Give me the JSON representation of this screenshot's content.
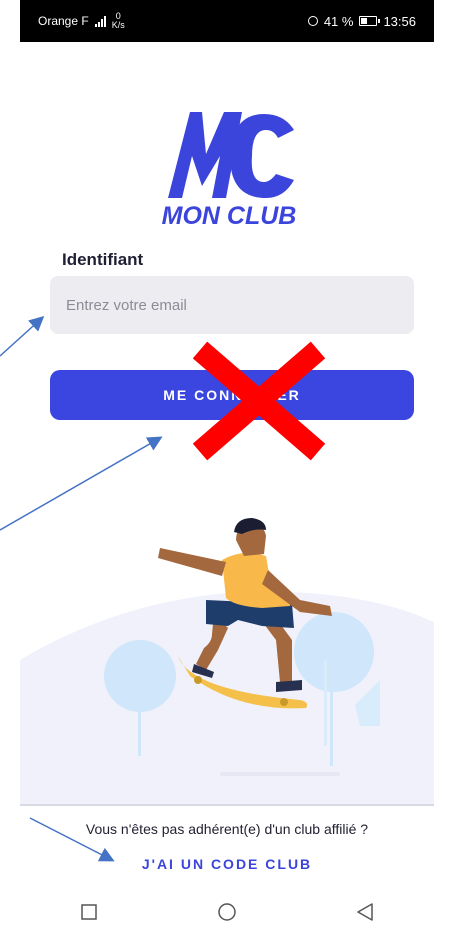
{
  "status_bar": {
    "carrier": "Orange F",
    "network": "4G",
    "speed_value": "0",
    "speed_unit": "K/s",
    "battery": "41 %",
    "battery_level_percent": 41,
    "time": "13:56"
  },
  "logo": {
    "monogram": "MC",
    "name": "MON CLUB"
  },
  "login": {
    "identifier_label": "Identifiant",
    "email_placeholder": "Entrez votre email",
    "email_value": "",
    "connect_button": "ME CONNECTER"
  },
  "footer": {
    "question": "Vous n'êtes pas adhérent(e) d'un club affilié ?",
    "code_club_link": "J'AI UN CODE CLUB"
  },
  "nav_bar": {
    "items": [
      "square-recent-apps-icon",
      "circle-home-icon",
      "triangle-back-icon"
    ]
  },
  "colors": {
    "brand": "#3b46e0",
    "input_background": "#ececf1",
    "annotation_arrow": "#4472c4",
    "annotation_cross": "#ff0000"
  }
}
